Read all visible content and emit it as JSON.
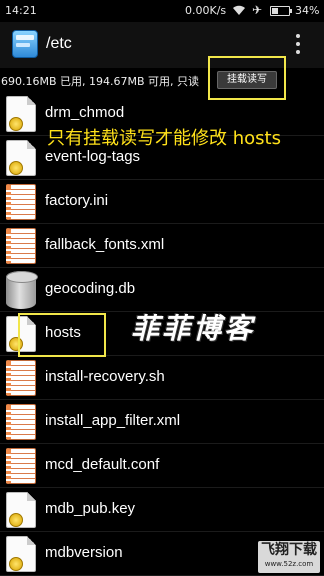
{
  "status_bar": {
    "time": "14:21",
    "network_speed": "0.00K/s",
    "battery": "34%",
    "battery_level": 0.34
  },
  "action_bar": {
    "path": "/etc",
    "app_icon": "file-manager-icon",
    "menu_icon": "overflow-menu-icon"
  },
  "info_bar": {
    "storage_text": "690.16MB 已用, 194.67MB 可用, 只读",
    "mount_button": "挂载读写"
  },
  "annotation": {
    "note": "只有挂载读写才能修改 hosts",
    "watermark": "菲菲博客",
    "site_logo": "飞翔下载",
    "site_url": "www.52z.com"
  },
  "files": [
    {
      "name": "drm_chmod",
      "icon": "doc-icon",
      "badge": true
    },
    {
      "name": "event-log-tags",
      "icon": "doc-icon",
      "badge": true
    },
    {
      "name": "factory.ini",
      "icon": "lined-doc-icon",
      "badge": false
    },
    {
      "name": "fallback_fonts.xml",
      "icon": "lined-doc-icon",
      "badge": false
    },
    {
      "name": "geocoding.db",
      "icon": "database-icon",
      "badge": false
    },
    {
      "name": "hosts",
      "icon": "doc-icon",
      "badge": true
    },
    {
      "name": "install-recovery.sh",
      "icon": "lined-doc-icon",
      "badge": false
    },
    {
      "name": "install_app_filter.xml",
      "icon": "lined-doc-icon",
      "badge": false
    },
    {
      "name": "mcd_default.conf",
      "icon": "lined-doc-icon",
      "badge": false
    },
    {
      "name": "mdb_pub.key",
      "icon": "doc-icon",
      "badge": true
    },
    {
      "name": "mdbversion",
      "icon": "doc-icon",
      "badge": true
    }
  ]
}
